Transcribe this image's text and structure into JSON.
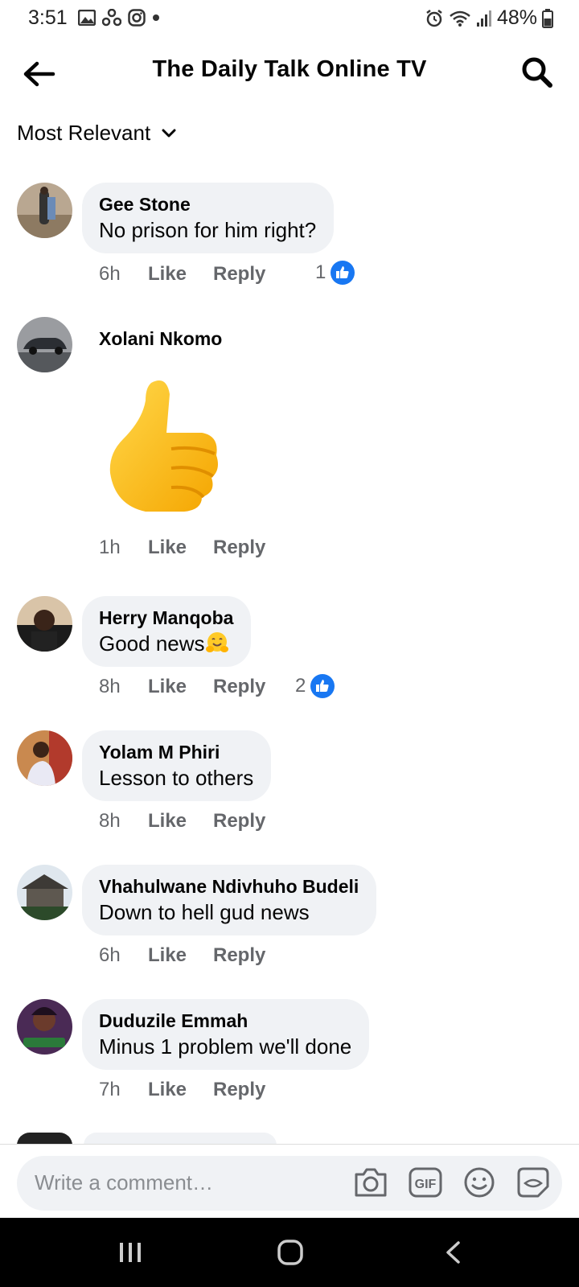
{
  "status_bar": {
    "time": "3:51",
    "battery": "48%"
  },
  "header": {
    "title": "The Daily Talk Online TV"
  },
  "sort": {
    "label": "Most Relevant"
  },
  "comments": [
    {
      "name": "Gee Stone",
      "text": "No prison for him right?",
      "time": "6h",
      "like": "Like",
      "reply": "Reply",
      "reactions": "1"
    },
    {
      "name": "Xolani Nkomo",
      "text": "",
      "time": "1h",
      "like": "Like",
      "reply": "Reply",
      "reactions": ""
    },
    {
      "name": "Herry Manqoba",
      "text": "Good news",
      "time": "8h",
      "like": "Like",
      "reply": "Reply",
      "reactions": "2"
    },
    {
      "name": "Yolam M Phiri",
      "text": "Lesson to others",
      "time": "8h",
      "like": "Like",
      "reply": "Reply",
      "reactions": ""
    },
    {
      "name": "Vhahulwane Ndivhuho Budeli",
      "text": "Down to hell gud news",
      "time": "6h",
      "like": "Like",
      "reply": "Reply",
      "reactions": ""
    },
    {
      "name": "Duduzile Emmah",
      "text": "Minus 1 problem  we'll done",
      "time": "7h",
      "like": "Like",
      "reply": "Reply",
      "reactions": ""
    }
  ],
  "composer": {
    "placeholder": "Write a comment…",
    "gif_label": "GIF"
  }
}
